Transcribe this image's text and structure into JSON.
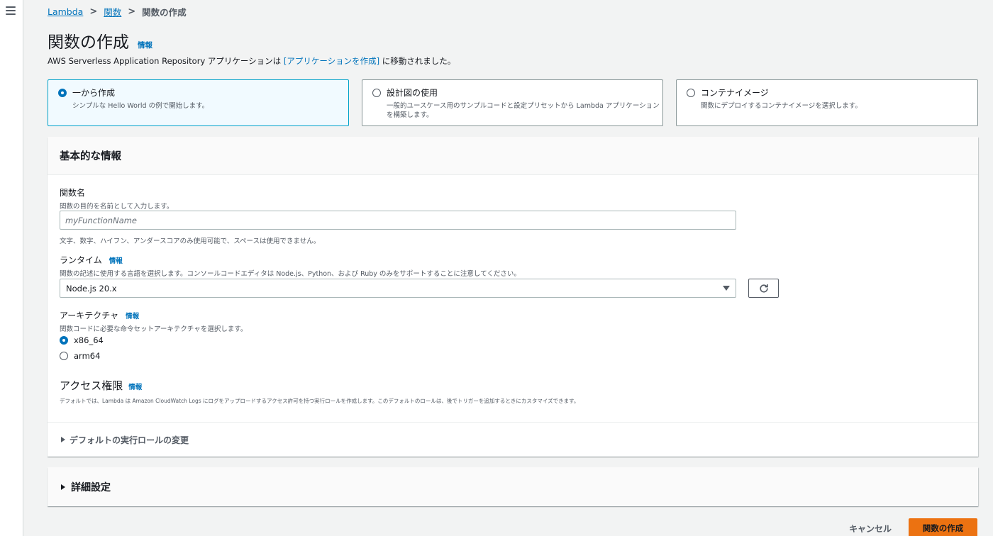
{
  "breadcrumb": {
    "items": [
      "Lambda",
      "関数"
    ],
    "current": "関数の作成"
  },
  "page": {
    "title": "関数の作成",
    "info": "情報",
    "notice_prefix": "AWS Serverless Application Repository アプリケーションは ",
    "notice_link": "[アプリケーションを作成]",
    "notice_suffix": " に移動されました。"
  },
  "options": [
    {
      "title": "一から作成",
      "desc": "シンプルな Hello World の例で開始します。",
      "selected": true
    },
    {
      "title": "設計図の使用",
      "desc": "一般的ユースケース用のサンプルコードと設定プリセットから Lambda アプリケーションを構築します。",
      "selected": false
    },
    {
      "title": "コンテナイメージ",
      "desc": "関数にデプロイするコンテナイメージを選択します。",
      "selected": false
    }
  ],
  "basic": {
    "header": "基本的な情報",
    "function_name": {
      "label": "関数名",
      "desc": "関数の目的を名前として入力します。",
      "placeholder": "myFunctionName",
      "value": "",
      "hint": "文字、数字、ハイフン、アンダースコアのみ使用可能で、スペースは使用できません。"
    },
    "runtime": {
      "label": "ランタイム",
      "info": "情報",
      "desc": "関数の記述に使用する言語を選択します。コンソールコードエディタは Node.js、Python、および Ruby のみをサポートすることに注意してください。",
      "value": "Node.js 20.x"
    },
    "architecture": {
      "label": "アーキテクチャ",
      "info": "情報",
      "desc": "関数コードに必要な命令セットアーキテクチャを選択します。",
      "options": [
        {
          "label": "x86_64",
          "selected": true
        },
        {
          "label": "arm64",
          "selected": false
        }
      ]
    },
    "access": {
      "title": "アクセス権限",
      "info": "情報",
      "desc": "デフォルトでは、Lambda は Amazon CloudWatch Logs にログをアップロードするアクセス許可を持つ実行ロールを作成します。このデフォルトのロールは、後でトリガーを追加するときにカスタマイズできます。"
    },
    "change_role": "デフォルトの実行ロールの変更"
  },
  "advanced": {
    "label": "詳細設定"
  },
  "actions": {
    "cancel": "キャンセル",
    "create": "関数の作成"
  },
  "colors": {
    "primary": "#ec7211",
    "link": "#0073bb",
    "selected_border": "#00a1c9"
  }
}
